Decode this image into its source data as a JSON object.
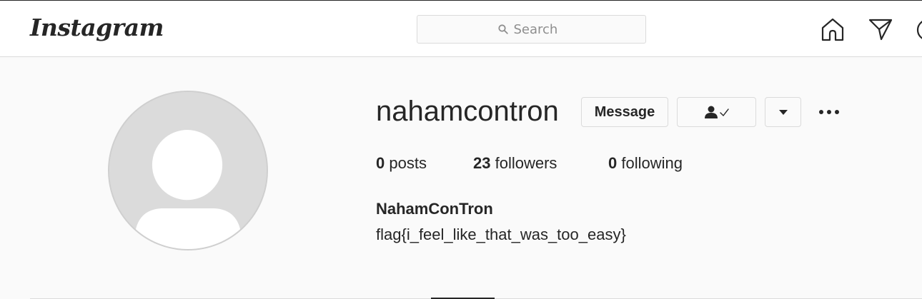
{
  "header": {
    "logo_text": "Instagram",
    "search": {
      "placeholder": "Search",
      "icon": "search-icon"
    },
    "nav_icons": [
      "home-icon",
      "direct-message-icon",
      "explore-icon"
    ]
  },
  "profile": {
    "username": "nahamcontron",
    "avatar_icon": "default-avatar-icon",
    "buttons": {
      "message_label": "Message",
      "following_icon": "user-check-icon",
      "dropdown_icon": "caret-down-icon",
      "more_icon": "more-options-icon"
    },
    "stats": {
      "posts_count": "0",
      "posts_label": "posts",
      "followers_count": "23",
      "followers_label": "followers",
      "following_count": "0",
      "following_label": "following"
    },
    "full_name": "NahamConTron",
    "bio": "flag{i_feel_like_that_was_too_easy}"
  },
  "colors": {
    "text": "#262626",
    "border": "#dbdbdb",
    "background": "#fafafa",
    "placeholder": "#8e8e8e"
  }
}
